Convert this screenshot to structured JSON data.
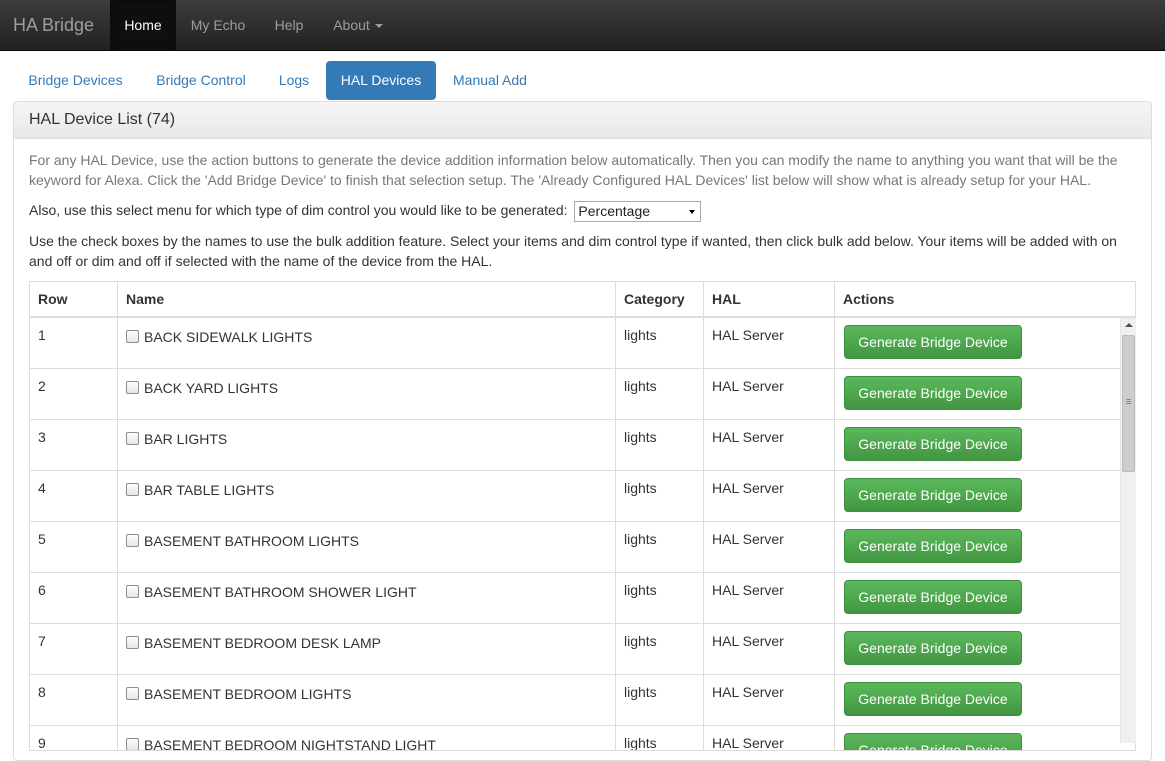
{
  "navbar": {
    "brand": "HA Bridge",
    "items": [
      {
        "label": "Home",
        "active": true
      },
      {
        "label": "My Echo",
        "active": false
      },
      {
        "label": "Help",
        "active": false
      },
      {
        "label": "About",
        "active": false,
        "dropdown": true
      }
    ]
  },
  "tabs": [
    {
      "label": "Bridge Devices",
      "active": false
    },
    {
      "label": "Bridge Control",
      "active": false
    },
    {
      "label": "Logs",
      "active": false
    },
    {
      "label": "HAL Devices",
      "active": true
    },
    {
      "label": "Manual Add",
      "active": false
    }
  ],
  "panel": {
    "title": "HAL Device List (74)",
    "intro_line1": "For any HAL Device, use the action buttons to generate the device addition information below automatically. Then you can modify the name to anything you want that will be the",
    "intro_line2": "keyword for Alexa. Click the 'Add Bridge Device' to finish that selection setup. The 'Already Configured HAL Devices' list below will show what is already setup for your HAL.",
    "dim_label": "Also, use this select menu for which type of dim control you would like to be generated:",
    "dim_select_value": "Percentage",
    "bulk_line1": "Use the check boxes by the names to use the bulk addition feature. Select your items and dim control type if wanted, then click bulk add below. Your items will be added with on",
    "bulk_line2": "and off or dim and off if selected with the name of the device from the HAL."
  },
  "table": {
    "headers": {
      "row": "Row",
      "name": "Name",
      "category": "Category",
      "hal": "HAL",
      "actions": "Actions"
    },
    "action_label": "Generate Bridge Device",
    "rows": [
      {
        "row": "1",
        "name": "BACK SIDEWALK LIGHTS",
        "category": "lights",
        "hal": "HAL Server"
      },
      {
        "row": "2",
        "name": "BACK YARD LIGHTS",
        "category": "lights",
        "hal": "HAL Server"
      },
      {
        "row": "3",
        "name": "BAR LIGHTS",
        "category": "lights",
        "hal": "HAL Server"
      },
      {
        "row": "4",
        "name": "BAR TABLE LIGHTS",
        "category": "lights",
        "hal": "HAL Server"
      },
      {
        "row": "5",
        "name": "BASEMENT BATHROOM LIGHTS",
        "category": "lights",
        "hal": "HAL Server"
      },
      {
        "row": "6",
        "name": "BASEMENT BATHROOM SHOWER LIGHT",
        "category": "lights",
        "hal": "HAL Server"
      },
      {
        "row": "7",
        "name": "BASEMENT BEDROOM DESK LAMP",
        "category": "lights",
        "hal": "HAL Server"
      },
      {
        "row": "8",
        "name": "BASEMENT BEDROOM LIGHTS",
        "category": "lights",
        "hal": "HAL Server"
      },
      {
        "row": "9",
        "name": "BASEMENT BEDROOM NIGHTSTAND LIGHT",
        "category": "lights",
        "hal": "HAL Server"
      }
    ]
  },
  "colors": {
    "navbar_bg": "#222222",
    "link": "#337ab7",
    "button_green": "#5cb85c"
  }
}
